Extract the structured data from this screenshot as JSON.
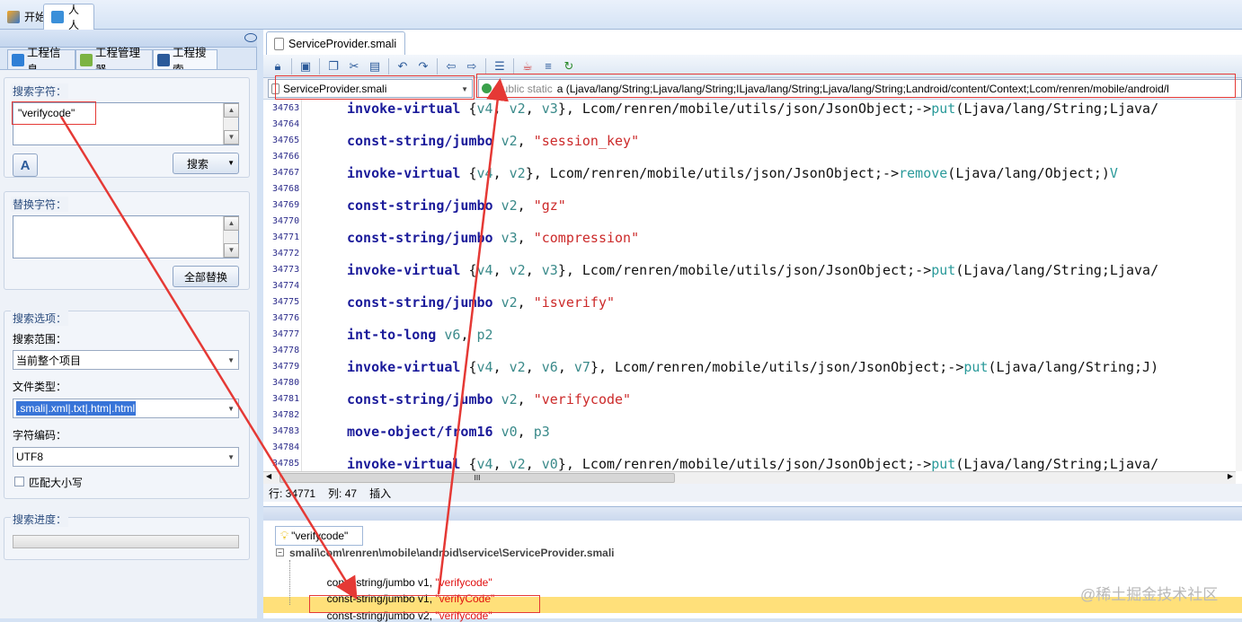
{
  "main_tabs": [
    {
      "label": "开始"
    },
    {
      "label": "人人"
    }
  ],
  "left_tabs": [
    {
      "label": "工程信息"
    },
    {
      "label": "工程管理器"
    },
    {
      "label": "工程搜索"
    }
  ],
  "search": {
    "search_label": "搜索字符：",
    "search_value": "\"verifycode\"",
    "search_button": "搜索",
    "replace_label": "替换字符：",
    "replace_value": "",
    "replace_all_button": "全部替换",
    "options_label": "搜索选项：",
    "scope_label": "搜索范围：",
    "scope_value": "当前整个项目",
    "filetype_label": "文件类型：",
    "filetype_value": ".smali|.xml|.txt|.htm|.html",
    "encoding_label": "字符编码：",
    "encoding_value": "UTF8",
    "match_case_label": "匹配大小写",
    "progress_label": "搜索进度："
  },
  "editor": {
    "file_tab": "ServiceProvider.smali",
    "file_dropdown": "ServiceProvider.smali",
    "method_modifier": "public static",
    "method_signature": "a (Ljava/lang/String;Ljava/lang/String;ILjava/lang/String;Ljava/lang/String;Landroid/content/Context;Lcom/renren/mobile/android/l",
    "line_numbers": [
      "34763",
      "34764",
      "34765",
      "34766",
      "34767",
      "34768",
      "34769",
      "34770",
      "34771",
      "34772",
      "34773",
      "34774",
      "34775",
      "34776",
      "34777",
      "34778",
      "34779",
      "34780",
      "34781",
      "34782",
      "34783",
      "34784",
      "34785"
    ],
    "code_lines": [
      [
        {
          "t": "invoke-virtual",
          "c": "kw"
        },
        {
          "t": " {"
        },
        {
          "t": "v4",
          "c": "reg"
        },
        {
          "t": ", "
        },
        {
          "t": "v2",
          "c": "reg"
        },
        {
          "t": ", "
        },
        {
          "t": "v3",
          "c": "reg"
        },
        {
          "t": "}, Lcom/renren/mobile/utils/json/JsonObject;->"
        },
        {
          "t": "put",
          "c": "mth"
        },
        {
          "t": "(Ljava/lang/String;Ljava/"
        }
      ],
      [
        {
          "t": "const-string/jumbo",
          "c": "kw"
        },
        {
          "t": " "
        },
        {
          "t": "v2",
          "c": "reg"
        },
        {
          "t": ", "
        },
        {
          "t": "\"session_key\"",
          "c": "str"
        }
      ],
      [
        {
          "t": "invoke-virtual",
          "c": "kw"
        },
        {
          "t": " {"
        },
        {
          "t": "v4",
          "c": "reg"
        },
        {
          "t": ", "
        },
        {
          "t": "v2",
          "c": "reg"
        },
        {
          "t": "}, Lcom/renren/mobile/utils/json/JsonObject;->"
        },
        {
          "t": "remove",
          "c": "mth"
        },
        {
          "t": "(Ljava/lang/Object;)"
        },
        {
          "t": "V",
          "c": "mth"
        }
      ],
      [
        {
          "t": "const-string/jumbo",
          "c": "kw"
        },
        {
          "t": " "
        },
        {
          "t": "v2",
          "c": "reg"
        },
        {
          "t": ", "
        },
        {
          "t": "\"gz\"",
          "c": "str"
        }
      ],
      [
        {
          "t": "const-string/jumbo",
          "c": "kw"
        },
        {
          "t": " "
        },
        {
          "t": "v3",
          "c": "reg"
        },
        {
          "t": ", "
        },
        {
          "t": "\"compression\"",
          "c": "str"
        }
      ],
      [
        {
          "t": "invoke-virtual",
          "c": "kw"
        },
        {
          "t": " {"
        },
        {
          "t": "v4",
          "c": "reg"
        },
        {
          "t": ", "
        },
        {
          "t": "v2",
          "c": "reg"
        },
        {
          "t": ", "
        },
        {
          "t": "v3",
          "c": "reg"
        },
        {
          "t": "}, Lcom/renren/mobile/utils/json/JsonObject;->"
        },
        {
          "t": "put",
          "c": "mth"
        },
        {
          "t": "(Ljava/lang/String;Ljava/"
        }
      ],
      [
        {
          "t": "const-string/jumbo",
          "c": "kw"
        },
        {
          "t": " "
        },
        {
          "t": "v2",
          "c": "reg"
        },
        {
          "t": ", "
        },
        {
          "t": "\"isverify\"",
          "c": "str"
        }
      ],
      [
        {
          "t": "int-to-long",
          "c": "kw"
        },
        {
          "t": " "
        },
        {
          "t": "v6",
          "c": "reg"
        },
        {
          "t": ", "
        },
        {
          "t": "p2",
          "c": "reg"
        }
      ],
      [
        {
          "t": "invoke-virtual",
          "c": "kw"
        },
        {
          "t": " {"
        },
        {
          "t": "v4",
          "c": "reg"
        },
        {
          "t": ", "
        },
        {
          "t": "v2",
          "c": "reg"
        },
        {
          "t": ", "
        },
        {
          "t": "v6",
          "c": "reg"
        },
        {
          "t": ", "
        },
        {
          "t": "v7",
          "c": "reg"
        },
        {
          "t": "}, Lcom/renren/mobile/utils/json/JsonObject;->"
        },
        {
          "t": "put",
          "c": "mth"
        },
        {
          "t": "(Ljava/lang/String;J)"
        }
      ],
      [
        {
          "t": "const-string/jumbo",
          "c": "kw"
        },
        {
          "t": " "
        },
        {
          "t": "v2",
          "c": "reg"
        },
        {
          "t": ", "
        },
        {
          "t": "\"verifycode\"",
          "c": "str"
        }
      ],
      [
        {
          "t": "move-object/from16",
          "c": "kw"
        },
        {
          "t": " "
        },
        {
          "t": "v0",
          "c": "reg"
        },
        {
          "t": ", "
        },
        {
          "t": "p3",
          "c": "reg"
        }
      ],
      [
        {
          "t": "invoke-virtual",
          "c": "kw"
        },
        {
          "t": " {"
        },
        {
          "t": "v4",
          "c": "reg"
        },
        {
          "t": ", "
        },
        {
          "t": "v2",
          "c": "reg"
        },
        {
          "t": ", "
        },
        {
          "t": "v0",
          "c": "reg"
        },
        {
          "t": "}, Lcom/renren/mobile/utils/json/JsonObject;->"
        },
        {
          "t": "put",
          "c": "mth"
        },
        {
          "t": "(Ljava/lang/String;Ljava/"
        }
      ]
    ],
    "hscroll_grip": "III"
  },
  "status": {
    "line": "行: 34771",
    "col": "列: 47",
    "mode": "插入"
  },
  "results": {
    "tab_label": "\"verifycode\"",
    "file_path": "smali\\com\\renren\\mobile\\android\\service\\ServiceProvider.smali",
    "rows": [
      {
        "code": "const-string/jumbo v1, ",
        "match": "\"verifycode\""
      },
      {
        "code": "const-string/jumbo v1, ",
        "match": "\"verifyCode\""
      },
      {
        "code": "const-string/jumbo v2, ",
        "match": "\"verifycode\""
      }
    ]
  },
  "watermark": "@稀土掘金技术社区",
  "colors": {
    "accent": "#2b5a9a",
    "annotation": "#e53935",
    "highlight_row": "#ffe07a",
    "string": "#cc2a2a",
    "keyword": "#1a1a9a"
  }
}
